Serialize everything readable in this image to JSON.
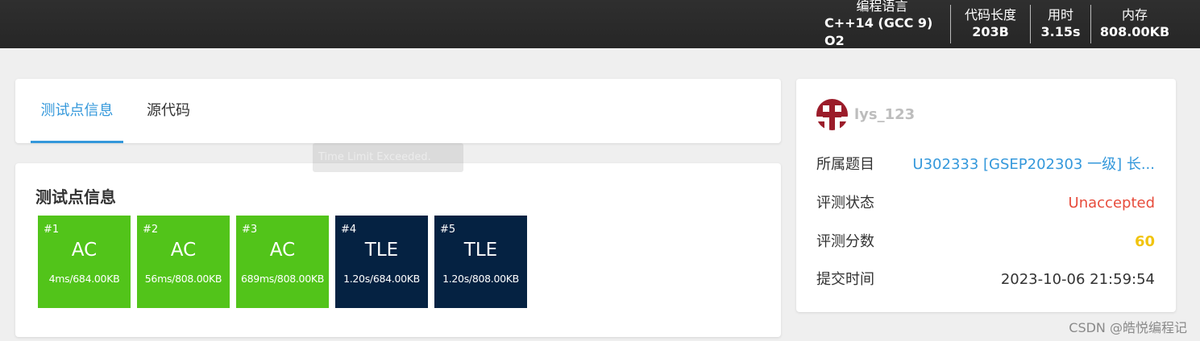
{
  "header": {
    "language_label": "编程语言",
    "language_value": "C++14 (GCC 9) O2",
    "code_length_label": "代码长度",
    "code_length_value": "203B",
    "time_label": "用时",
    "time_value": "3.15s",
    "memory_label": "内存",
    "memory_value": "808.00KB"
  },
  "tabs": {
    "testpoints": "测试点信息",
    "source": "源代码"
  },
  "tooltip": "Time Limit Exceeded.",
  "testpoints": {
    "title": "测试点信息",
    "cases": [
      {
        "num": "#1",
        "status": "AC",
        "info": "4ms/684.00KB"
      },
      {
        "num": "#2",
        "status": "AC",
        "info": "56ms/808.00KB"
      },
      {
        "num": "#3",
        "status": "AC",
        "info": "689ms/808.00KB"
      },
      {
        "num": "#4",
        "status": "TLE",
        "info": "1.20s/684.00KB"
      },
      {
        "num": "#5",
        "status": "TLE",
        "info": "1.20s/808.00KB"
      }
    ]
  },
  "record": {
    "username": "lys_123",
    "problem_label": "所属题目",
    "problem_value": "U302333 [GSEP202303 一级] 长...",
    "status_label": "评测状态",
    "status_value": "Unaccepted",
    "score_label": "评测分数",
    "score_value": "60",
    "submit_time_label": "提交时间",
    "submit_time_value": "2023-10-06 21:59:54"
  },
  "watermark": "CSDN @皓悦编程记",
  "colors": {
    "accepted": "#52c41a",
    "tle": "#052242",
    "link": "#3498db",
    "unaccepted": "#e74c3c",
    "score": "#f1c40f"
  }
}
